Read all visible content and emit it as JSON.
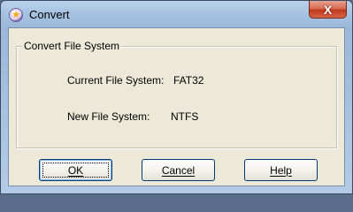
{
  "window": {
    "title": "Convert",
    "close_symbol": "X",
    "icon": "convert-app-icon"
  },
  "groupbox": {
    "legend": "Convert File System",
    "current_label": "Current File System:",
    "current_value": "FAT32",
    "new_label": "New File System:",
    "new_value": "NTFS"
  },
  "buttons": {
    "ok_label": "OK",
    "cancel_label": "Cancel",
    "help_label": "Help"
  }
}
